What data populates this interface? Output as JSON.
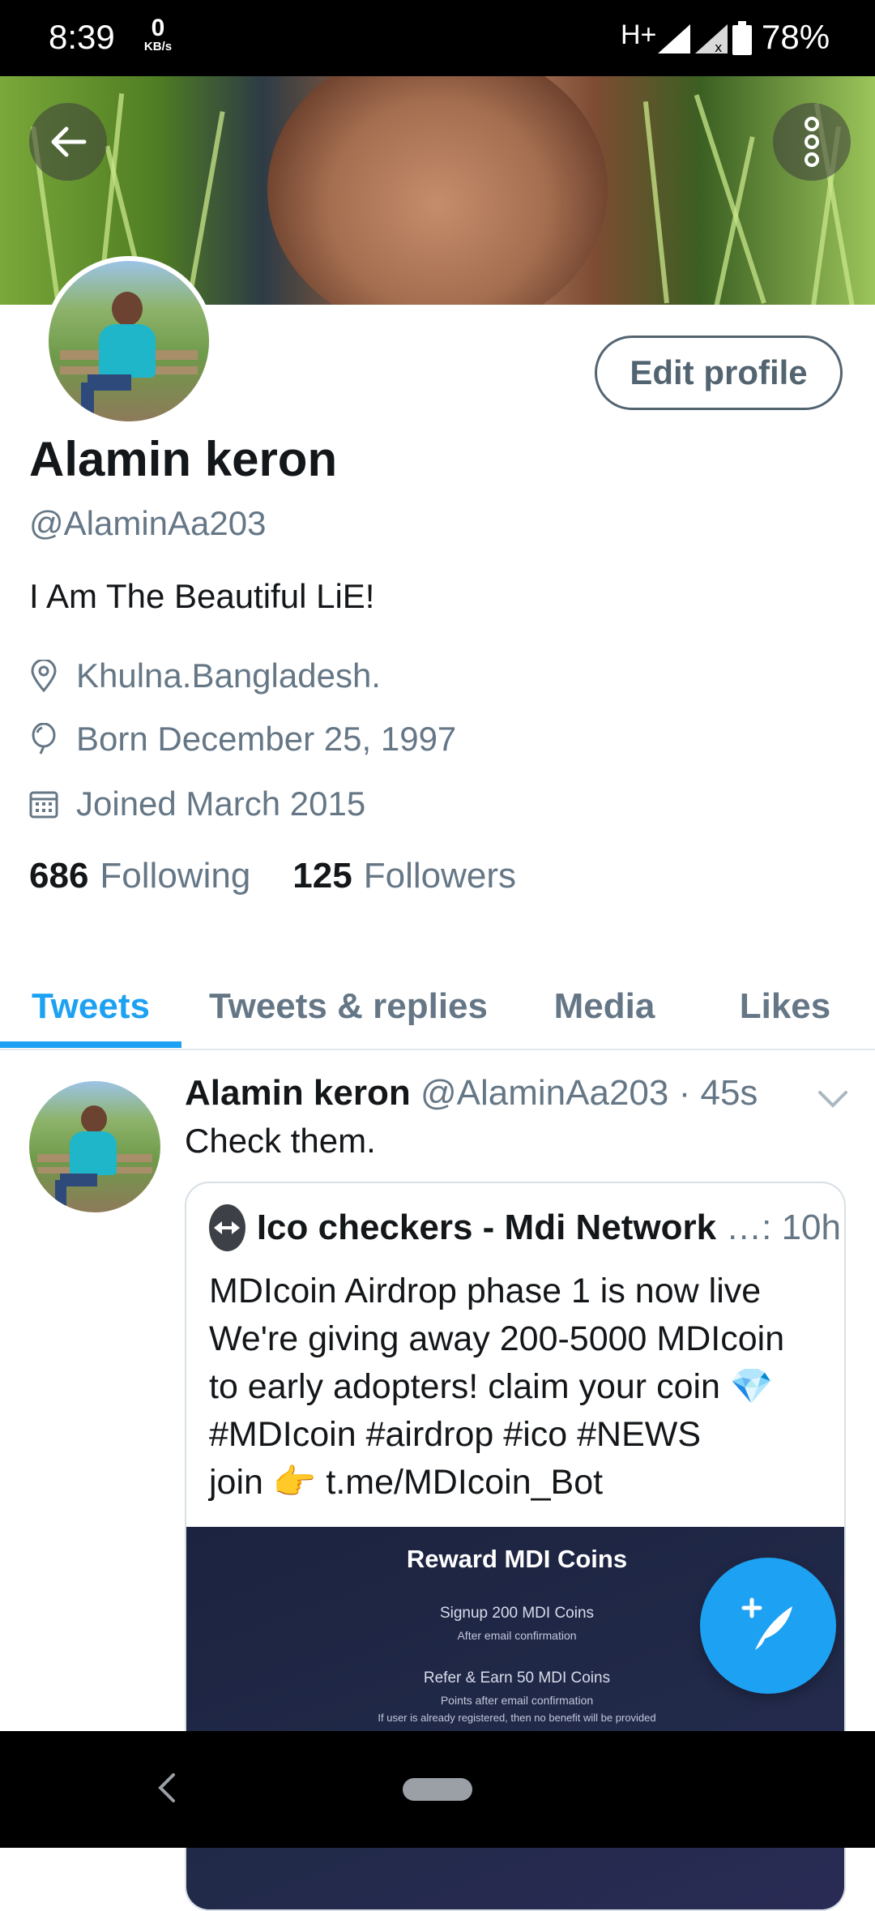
{
  "status_bar": {
    "time": "8:39",
    "speed_value": "0",
    "speed_unit": "KB/s",
    "network": "H+",
    "battery": "78%"
  },
  "profile": {
    "name": "Alamin keron",
    "handle": "@AlaminAa203",
    "bio": "I Am The Beautiful LiE!",
    "location": "Khulna.Bangladesh.",
    "birthday": "Born December 25, 1997",
    "joined": "Joined March 2015",
    "following_count": "686",
    "following_label": "Following",
    "followers_count": "125",
    "followers_label": "Followers",
    "edit_label": "Edit profile"
  },
  "tabs": [
    {
      "label": "Tweets",
      "active": true
    },
    {
      "label": "Tweets & replies",
      "active": false
    },
    {
      "label": "Media",
      "active": false
    },
    {
      "label": "Likes",
      "active": false
    }
  ],
  "tweet": {
    "name": "Alamin keron",
    "handle_time": "@AlaminAa203 · 45s",
    "text": "Check them.",
    "quote": {
      "name": "Ico checkers - Mdi Network",
      "ellipsis": "…:",
      "time": "10h",
      "lines": [
        "MDIcoin Airdrop phase 1 is now live",
        "We're giving away 200-5000 MDIcoin",
        "to early adopters! claim your coin 💎",
        "#MDIcoin #airdrop #ico #NEWS",
        "join 👉 t.me/MDIcoin_Bot"
      ],
      "image": {
        "title": "Reward MDI Coins",
        "line1": "Signup 200 MDI Coins",
        "line2": "After email confirmation",
        "line3": "Refer & Earn 50 MDI Coins",
        "line4": "Points after email confirmation",
        "line5": "If user is already registered, then no benefit will be provided"
      }
    }
  },
  "colors": {
    "accent": "#1da1f2",
    "secondary_text": "#657786",
    "primary_text": "#14171a"
  }
}
